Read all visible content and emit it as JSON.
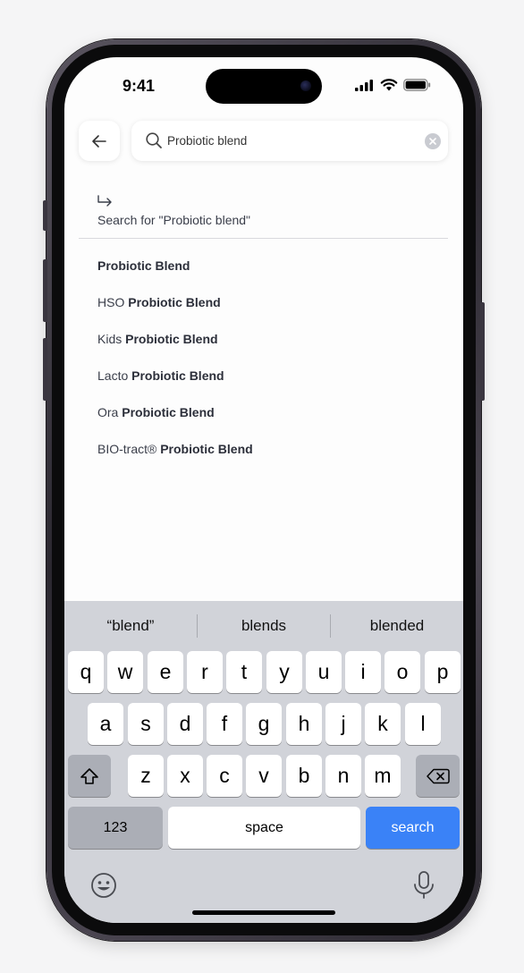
{
  "status_bar": {
    "time": "9:41"
  },
  "search": {
    "value": "Probiotic blend",
    "search_for_label": "Search for \"Probiotic blend\""
  },
  "suggestions": [
    {
      "prefix": "",
      "match": "Probiotic Blend"
    },
    {
      "prefix": "HSO ",
      "match": "Probiotic Blend"
    },
    {
      "prefix": "Kids ",
      "match": "Probiotic Blend"
    },
    {
      "prefix": "Lacto ",
      "match": "Probiotic Blend"
    },
    {
      "prefix": "Ora ",
      "match": "Probiotic Blend"
    },
    {
      "prefix": "BIO-tract® ",
      "match": "Probiotic Blend"
    }
  ],
  "keyboard": {
    "predictions": [
      "“blend”",
      "blends",
      "blended"
    ],
    "row1": [
      "q",
      "w",
      "e",
      "r",
      "t",
      "y",
      "u",
      "i",
      "o",
      "p"
    ],
    "row2": [
      "a",
      "s",
      "d",
      "f",
      "g",
      "h",
      "j",
      "k",
      "l"
    ],
    "row3": [
      "z",
      "x",
      "c",
      "v",
      "b",
      "n",
      "m"
    ],
    "numbers_label": "123",
    "space_label": "space",
    "search_label": "search"
  },
  "icons": {
    "back": "arrow-left-icon",
    "search": "magnifier-icon",
    "clear": "clear-x-icon",
    "search_for": "arrow-return-icon",
    "shift": "shift-icon",
    "delete": "backspace-icon",
    "emoji": "emoji-icon",
    "dictation": "microphone-icon"
  },
  "colors": {
    "search_key": "#3a82f7",
    "caret": "#1c7a4a",
    "text_muted": "#3a3e4a"
  }
}
